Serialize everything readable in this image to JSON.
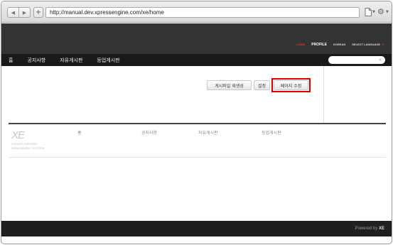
{
  "browser": {
    "url": "http://manual.dev.xpressengine.com/xe/home",
    "back_glyph": "◀",
    "forward_glyph": "▶",
    "add_glyph": "+",
    "icons": [
      "back-icon",
      "forward-icon",
      "add-tab-icon",
      "page-icon",
      "gear-icon"
    ]
  },
  "header": {
    "links": {
      "login": "LOGIN",
      "profile": "PROFILE",
      "language": "KOREAN",
      "select_language": "SELECT LANGUAGE"
    }
  },
  "nav": {
    "items": [
      "홈",
      "공지사항",
      "자유게시판",
      "등업게시판"
    ],
    "search_placeholder": ""
  },
  "content": {
    "buttons": {
      "file_create": "게시파일 재생성",
      "settings": "설정",
      "edit_page": "페이지 수정"
    }
  },
  "footer": {
    "logo_text": "XE",
    "logo_sub_1": "CLEVER CONTENT",
    "logo_sub_2": "MANAGEMENT SYSTEM",
    "menu": [
      "홈",
      "공지사항",
      "자유게시판",
      "등업게시판"
    ],
    "powered_prefix": "Powered by",
    "powered_brand": "XE"
  },
  "colors": {
    "header_bg": "#333333",
    "nav_bg": "#1a1a1a",
    "login_accent": "#ee3322",
    "highlight_box": "#dd0000"
  }
}
